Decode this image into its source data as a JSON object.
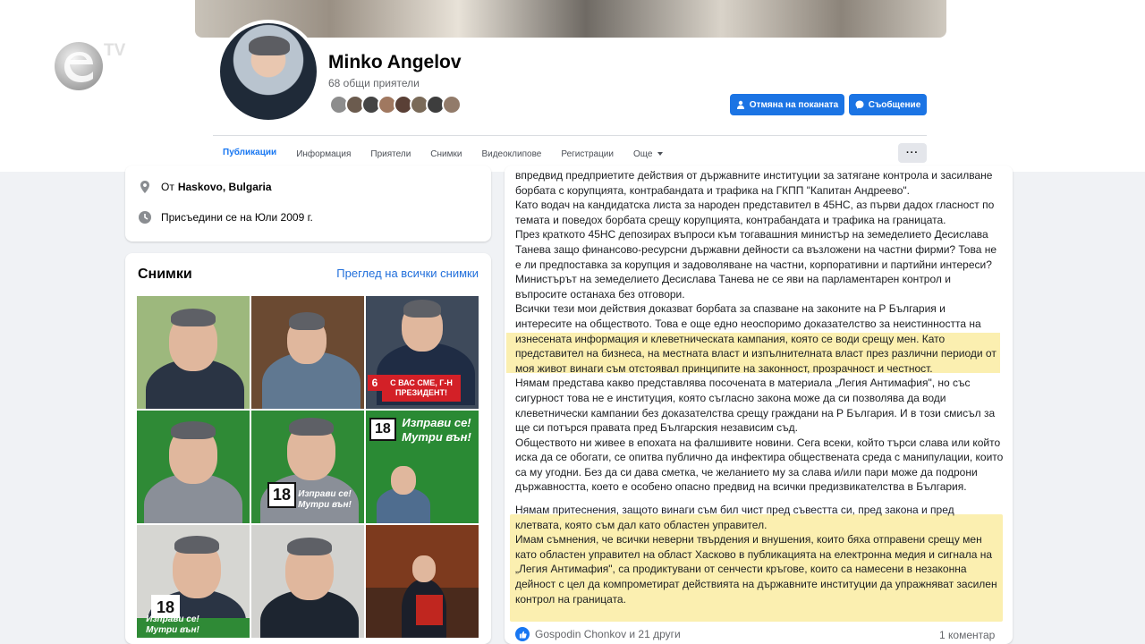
{
  "channel_logo": {
    "text": "TV"
  },
  "profile": {
    "name": "Minko Angelov",
    "mutual_friends": "68 общи приятели",
    "cancel_invite_label": "Отмяна на поканата",
    "message_label": "Съобщение"
  },
  "tabs": [
    {
      "label": "Публикации",
      "active": true
    },
    {
      "label": "Информация"
    },
    {
      "label": "Приятели"
    },
    {
      "label": "Снимки"
    },
    {
      "label": "Видеоклипове"
    },
    {
      "label": "Регистрации"
    },
    {
      "label": "Още"
    }
  ],
  "more_button": "···",
  "intro": {
    "from_prefix": "От",
    "from_place": "Haskovo, Bulgaria",
    "joined": "Присъедини се на Юли 2009 г."
  },
  "photos": {
    "title": "Снимки",
    "see_all": "Преглед на всички снимки",
    "tv_number": "6",
    "tv_banner": "С ВАС СМЕ, Г-Н ПРЕЗИДЕНТ!",
    "badge": "18",
    "slogan_big": "Изправи се! Мутри вън!",
    "slogan_small": "Изправи се! Мутри вън!"
  },
  "post": {
    "paragraphs_top": [
      "впредвид предприетите действия от държавните институции за затягане контрола и засилване борбата с корупцията, контрабандата и трафика на ГКПП \"Капитан Андреево\".",
      "Като водач на кандидатска листа за народен представител в 45НС, аз първи дадох гласност по темата и поведох борбата срещу корупцията, контрабандата и трафика на границата.",
      "През краткото 45НС депозирах въпроси към тогавашния министър на земеделието Десислава Танева защо финансово-ресурсни държавни дейности са възложени на частни фирми? Това не е ли предпоставка за корупция и задоволяване на частни, корпоративни и партийни интереси? Министърът на земеделието Десислава Танева не се яви на парламентарен контрол и въпросите останаха без отговори.",
      "Всички тези мои действия доказват борбата за спазване на законите на Р България и интересите на обществото. Това е още едно неоспоримо доказателство за неистинността на изнесената информация и клеветническата кампания, която се води срещу мен."
    ],
    "highlight_1": "Като представител на бизнеса, на местната власт и изпълнителната власт през различни периоди от моя живот винаги съм отстоявал принципите на законност, прозрачност и честност.",
    "paragraphs_mid": [
      "Нямам представа какво представлява посочената в материала „Легия Антимафия\", но със сигурност това не е институция, която съгласно закона може да си позволява да води клеветнически кампании без доказателства срещу граждани на Р България. И в този смисъл за ще си потърся правата пред Българския независим съд.",
      "Обществото ни живее в епохата на фалшивите новини. Сега всеки, който търси слава или който иска да се обогати, се опитва публично да инфектира обществената среда с манипулации, които са му угодни. Без да си дава сметка, че желанието му за слава и/или пари може да подрони държавността, което е особено опасно предвид на всички предизвикателства в България."
    ],
    "highlight_2": [
      "Нямам притеснения, защото винаги съм бил чист пред съвестта си, пред закона и пред клетвата, която съм дал като областен управител.",
      "Имам съмнения, че всички неверни твърдения и внушения, които бяха отправени срещу мен като областен управител на област Хасково в публикацията на електронна медия и сигнала на „Легия Антимафия\", са продиктувани от сенчести кръгове, които са намесени в незаконна дейност с цел да компрометират действията на държавните институции да упражняват засилен контрол на границата."
    ],
    "reactions": "Gospodin Chonkov и 21 други",
    "comments": "1 коментар"
  },
  "colors": {
    "accent": "#1b74e4",
    "highlight": "#fbefb0",
    "link": "#216fdb"
  },
  "icons": [
    "location-pin-icon",
    "clock-icon",
    "person-icon",
    "messenger-icon",
    "like-icon",
    "chevron-down-icon"
  ]
}
